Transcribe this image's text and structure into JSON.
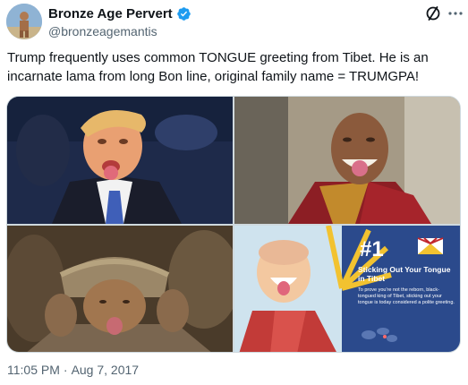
{
  "author": {
    "display_name": "Bronze Age Pervert",
    "handle": "@bronzeagemantis",
    "verified_color": "#1d9bf0"
  },
  "tweet": {
    "text": "Trump frequently uses common TONGUE greeting from Tibet. He is an incarnate lama from long Bon line, original family name = TRUMGPA!",
    "time": "11:05 PM",
    "separator": "·",
    "date": "Aug 7, 2017"
  },
  "media": {
    "images": [
      {
        "subject": "man in suit sticking out tongue"
      },
      {
        "subject": "tibetan monk sticking out tongue"
      },
      {
        "subject": "man in fur hat sticking out tongue"
      },
      {
        "subject": "infographic monk sticking out tongue"
      }
    ],
    "infographic": {
      "number": "#1",
      "heading": "Sticking Out Your Tongue in Tibet",
      "body": "To prove you're not the reborn, black-tongued king of Tibet, sticking out your tongue is today considered a polite greeting.",
      "background_color": "#2b4a8c"
    }
  },
  "icons": {
    "header_action": "grok-slash-icon",
    "more": "more-horizontal-icon"
  }
}
